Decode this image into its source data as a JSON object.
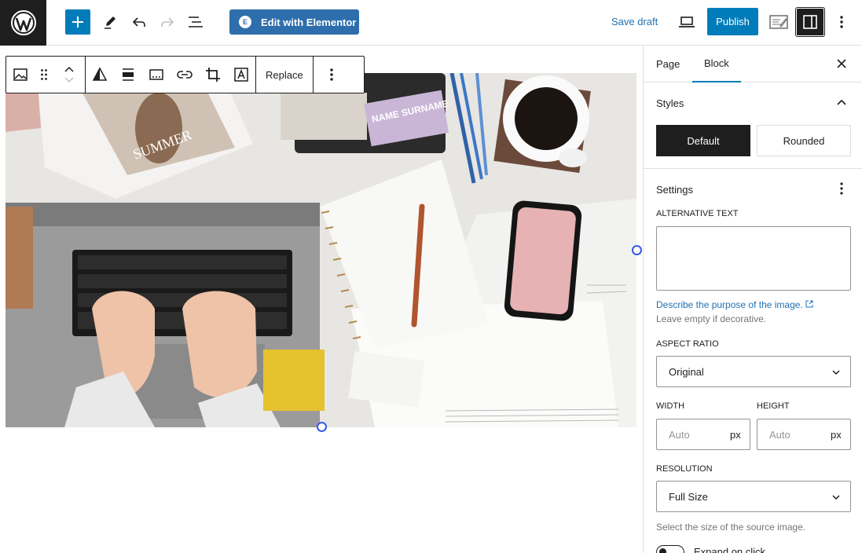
{
  "topbar": {
    "elementor_label": "Edit with Elementor",
    "elementor_badge": "E",
    "save_draft": "Save draft",
    "publish": "Publish"
  },
  "block_toolbar": {
    "replace_label": "Replace"
  },
  "image": {
    "magazine_title": "SUMMER",
    "card_text": "NAME SURNAME"
  },
  "sidebar": {
    "tabs": [
      {
        "label": "Page"
      },
      {
        "label": "Block"
      }
    ],
    "active_tab": "Block",
    "styles": {
      "title": "Styles",
      "options": [
        {
          "label": "Default"
        },
        {
          "label": "Rounded"
        }
      ],
      "selected": "Default"
    },
    "settings": {
      "title": "Settings",
      "alt_text_label": "ALTERNATIVE TEXT",
      "alt_text_value": "",
      "alt_link": "Describe the purpose of the image.",
      "alt_help": "Leave empty if decorative.",
      "aspect_label": "ASPECT RATIO",
      "aspect_value": "Original",
      "width_label": "WIDTH",
      "width_placeholder": "Auto",
      "width_unit": "px",
      "height_label": "HEIGHT",
      "height_placeholder": "Auto",
      "height_unit": "px",
      "resolution_label": "RESOLUTION",
      "resolution_value": "Full Size",
      "resolution_help": "Select the size of the source image.",
      "expand_label": "Expand on click"
    }
  },
  "colors": {
    "accent": "#007cba",
    "elementor": "#2e6eac",
    "link": "#2271b1",
    "dark": "#1e1e1e",
    "handle": "#3858e9"
  }
}
